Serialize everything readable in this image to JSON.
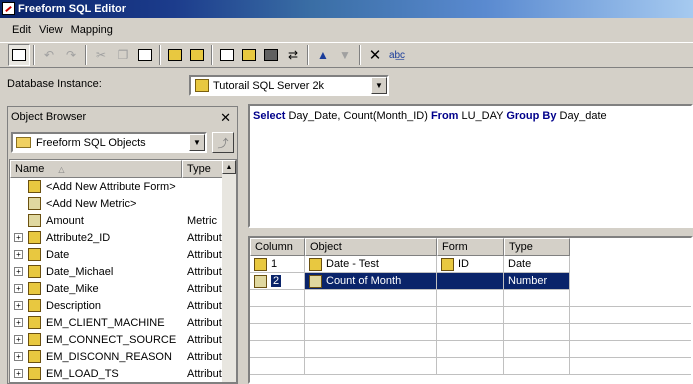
{
  "window": {
    "title": "Freeform SQL Editor"
  },
  "menu": [
    "Edit",
    "View",
    "Mapping"
  ],
  "toolbar": {
    "buttons": [
      "preview-icon",
      "undo-icon",
      "redo-icon",
      "cut-icon",
      "copy-icon",
      "paste-icon",
      "add-attribute-icon",
      "add-metric-icon",
      "properties-icon",
      "hierarchy-icon",
      "replace-icon",
      "move-up-icon",
      "move-down-icon",
      "delete-icon",
      "spell-check-icon"
    ]
  },
  "database": {
    "label": "Database Instance:",
    "selected": "Tutorail SQL Server 2k"
  },
  "object_browser": {
    "title": "Object Browser",
    "folder": "Freeform SQL Objects",
    "columns": {
      "name": "Name",
      "type": "Type"
    },
    "items": [
      {
        "name": "<Add New Attribute Form>",
        "type": ""
      },
      {
        "name": "<Add New Metric>",
        "type": ""
      },
      {
        "name": "Amount",
        "type": "Metric"
      },
      {
        "name": "Attribute2_ID",
        "type": "Attribute"
      },
      {
        "name": "Date",
        "type": "Attribute"
      },
      {
        "name": "Date_Michael",
        "type": "Attribute"
      },
      {
        "name": "Date_Mike",
        "type": "Attribute"
      },
      {
        "name": "Description",
        "type": "Attribute"
      },
      {
        "name": "EM_CLIENT_MACHINE",
        "type": "Attribute"
      },
      {
        "name": "EM_CONNECT_SOURCE",
        "type": "Attribute"
      },
      {
        "name": "EM_DISCONN_REASON",
        "type": "Attribute"
      },
      {
        "name": "EM_LOAD_TS",
        "type": "Attribute"
      }
    ]
  },
  "sql": {
    "kw_select": "Select",
    "cols": " Day_Date, Count(Month_ID) ",
    "kw_from": "From",
    "table": " LU_DAY ",
    "kw_group": "Group By",
    "group_col": " Day_date"
  },
  "mapping": {
    "columns": {
      "column": "Column",
      "object": "Object",
      "form": "Form",
      "type": "Type"
    },
    "rows": [
      {
        "column": "1",
        "object": "Date - Test",
        "form": "ID",
        "type": "Date"
      },
      {
        "column": "2",
        "object": "Count of Month",
        "form": "",
        "type": "Number"
      }
    ]
  }
}
